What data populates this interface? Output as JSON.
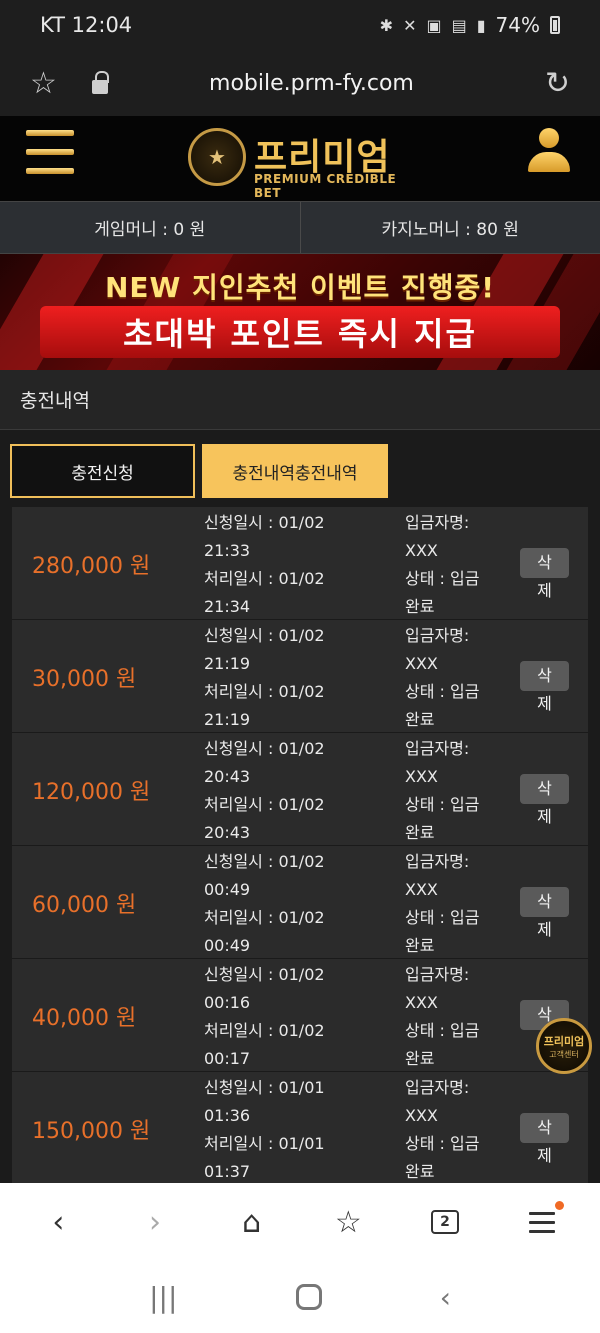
{
  "status_bar": {
    "carrier_time": "KT 12:04",
    "battery": "74%",
    "icons": [
      "bluetooth-icon",
      "mute-icon",
      "hd-icon",
      "5g-icon",
      "signal-icon",
      "battery-icon"
    ]
  },
  "browser": {
    "url": "mobile.prm-fy.com",
    "tab_count": "2"
  },
  "header": {
    "logo_title": "프리미엄",
    "logo_subtitle": "PREMIUM CREDIBLE BET"
  },
  "money": {
    "game_money": "게임머니 : 0 원",
    "casino_money": "카지노머니 : 80 원"
  },
  "banner": {
    "line1": "NEW 지인추천 이벤트 진행중!",
    "line2": "초대박 포인트 즉시 지급"
  },
  "section_title": "충전내역",
  "tabs": {
    "request": "충전신청",
    "history": "충전내역충전내역"
  },
  "records": [
    {
      "amount": "280,000 원",
      "req1": "신청일시 : 01/02",
      "req2": "21:33",
      "proc1": "처리일시 : 01/02",
      "proc2": "21:34",
      "dep1": "입금자명:",
      "dep2": "XXX",
      "st1": "상태 : 입금",
      "st2": "완료",
      "del1": "삭",
      "del2": "제"
    },
    {
      "amount": "30,000 원",
      "req1": "신청일시 : 01/02",
      "req2": "21:19",
      "proc1": "처리일시 : 01/02",
      "proc2": "21:19",
      "dep1": "입금자명:",
      "dep2": "XXX",
      "st1": "상태 : 입금",
      "st2": "완료",
      "del1": "삭",
      "del2": "제"
    },
    {
      "amount": "120,000 원",
      "req1": "신청일시 : 01/02",
      "req2": "20:43",
      "proc1": "처리일시 : 01/02",
      "proc2": "20:43",
      "dep1": "입금자명:",
      "dep2": "XXX",
      "st1": "상태 : 입금",
      "st2": "완료",
      "del1": "삭",
      "del2": "제"
    },
    {
      "amount": "60,000 원",
      "req1": "신청일시 : 01/02",
      "req2": "00:49",
      "proc1": "처리일시 : 01/02",
      "proc2": "00:49",
      "dep1": "입금자명:",
      "dep2": "XXX",
      "st1": "상태 : 입금",
      "st2": "완료",
      "del1": "삭",
      "del2": "제"
    },
    {
      "amount": "40,000 원",
      "req1": "신청일시 : 01/02",
      "req2": "00:16",
      "proc1": "처리일시 : 01/02",
      "proc2": "00:17",
      "dep1": "입금자명:",
      "dep2": "XXX",
      "st1": "상태 : 입금",
      "st2": "완료",
      "del1": "삭",
      "del2": "제"
    },
    {
      "amount": "150,000 원",
      "req1": "신청일시 : 01/01",
      "req2": "01:36",
      "proc1": "처리일시 : 01/01",
      "proc2": "01:37",
      "dep1": "입금자명:",
      "dep2": "XXX",
      "st1": "상태 : 입금",
      "st2": "완료",
      "del1": "삭",
      "del2": "제"
    }
  ],
  "floating_badge": {
    "title": "프리미엄",
    "subtitle": "고객센터"
  },
  "colors": {
    "accent_gold": "#f7c45c",
    "amount_orange": "#e8702a",
    "background": "#1b1b1b"
  }
}
